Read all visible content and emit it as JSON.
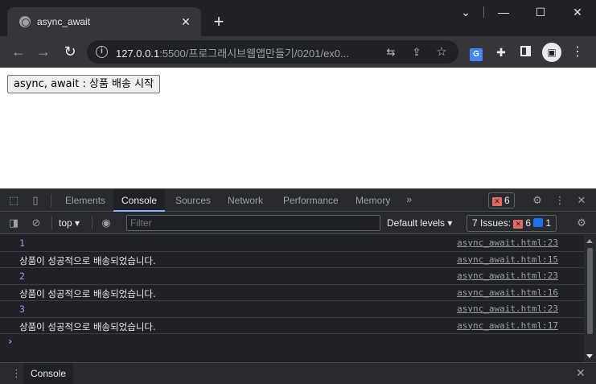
{
  "browser": {
    "tab_title": "async_await",
    "tab_close": "✕",
    "new_tab": "+",
    "window": {
      "chevron": "⌄",
      "minimize": "—",
      "maximize": "☐",
      "close": "✕"
    },
    "url_host": "127.0.0.1",
    "url_rest": ":5500/프로그래시브웹앱만들기/0201/ex0..."
  },
  "page": {
    "button_label": "async, await : 상품 배송 시작"
  },
  "devtools": {
    "tabs": [
      "Elements",
      "Console",
      "Sources",
      "Network",
      "Performance",
      "Memory"
    ],
    "active_tab": "Console",
    "more": "»",
    "error_count": "6",
    "context": "top ▾",
    "filter_placeholder": "Filter",
    "levels": "Default levels ▾",
    "issues_label": "7 Issues:",
    "issues_errors": "6",
    "issues_info": "1",
    "prompt": "›",
    "drawer_tab": "Console"
  },
  "console_rows": [
    {
      "text": "1",
      "source": "async_await.html:23"
    },
    {
      "text": "상품이 성공적으로 배송되었습니다.",
      "source": "async_await.html:15"
    },
    {
      "text": "2",
      "source": "async_await.html:23"
    },
    {
      "text": "상품이 성공적으로 배송되었습니다.",
      "source": "async_await.html:16"
    },
    {
      "text": "3",
      "source": "async_await.html:23"
    },
    {
      "text": "상품이 성공적으로 배송되었습니다.",
      "source": "async_await.html:17"
    }
  ],
  "colors": {
    "number_log": "#9d95ff",
    "error_red": "#e46962",
    "info_blue": "#1a73e8",
    "active_tab_underline": "#8ab4f8"
  }
}
